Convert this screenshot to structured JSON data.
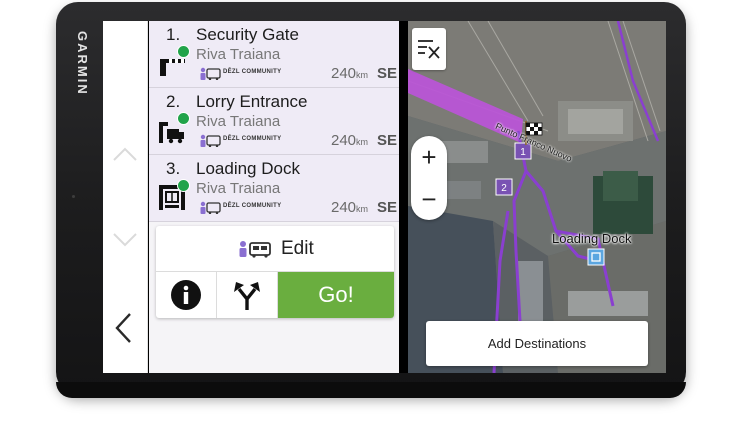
{
  "device": {
    "brand": "GARMIN"
  },
  "colors": {
    "accent_go": "#6aae3f",
    "status_dot": "#21a34a",
    "route": "#b56ad8",
    "list_item_bg": "#efebf6"
  },
  "left_nav": {
    "icons": [
      "chevron-up-icon",
      "chevron-down-icon",
      "back-arrow-icon"
    ]
  },
  "destinations": [
    {
      "number": "1.",
      "name": "Security Gate",
      "address": "Riva Traiana",
      "community": "DĒZL COMMUNITY",
      "distance": "240",
      "distance_unit": "km",
      "direction": "SE",
      "icon": "gate-barrier-icon"
    },
    {
      "number": "2.",
      "name": "Lorry Entrance",
      "address": "Riva Traiana",
      "community": "DĒZL COMMUNITY",
      "distance": "240",
      "distance_unit": "km",
      "direction": "SE",
      "icon": "truck-entrance-icon"
    },
    {
      "number": "3.",
      "name": "Loading Dock",
      "address": "Riva Traiana",
      "community": "DĒZL COMMUNITY",
      "distance": "240",
      "distance_unit": "km",
      "direction": "SE",
      "icon": "loading-dock-icon"
    }
  ],
  "actions": {
    "edit_label": "Edit",
    "go_label": "Go!"
  },
  "map": {
    "zoom_in": "+",
    "zoom_out": "−",
    "poi_label": "Loading Dock",
    "road_label": "Punto Franco Nuovo",
    "waypoints": [
      "1",
      "2"
    ],
    "add_destinations_label": "Add Destinations"
  }
}
